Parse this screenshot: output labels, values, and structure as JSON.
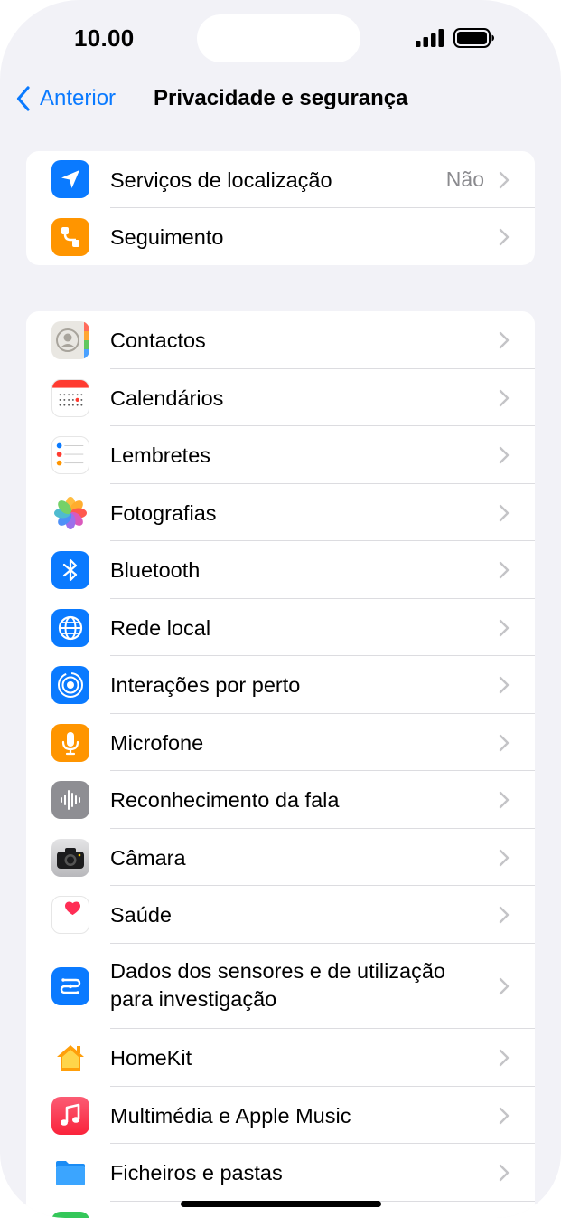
{
  "status_bar": {
    "time": "10.00"
  },
  "nav": {
    "back_label": "Anterior",
    "title": "Privacidade e segurança"
  },
  "group1": [
    {
      "label": "Serviços de localização",
      "value": "Não",
      "icon": "location-arrow-icon"
    },
    {
      "label": "Seguimento",
      "value": "",
      "icon": "tracking-icon"
    }
  ],
  "group2": [
    {
      "label": "Contactos",
      "icon": "contacts-icon"
    },
    {
      "label": "Calendários",
      "icon": "calendar-icon"
    },
    {
      "label": "Lembretes",
      "icon": "reminders-icon"
    },
    {
      "label": "Fotografias",
      "icon": "photos-icon"
    },
    {
      "label": "Bluetooth",
      "icon": "bluetooth-icon"
    },
    {
      "label": "Rede local",
      "icon": "globe-icon"
    },
    {
      "label": "Interações por perto",
      "icon": "nearby-interactions-icon"
    },
    {
      "label": "Microfone",
      "icon": "microphone-icon"
    },
    {
      "label": "Reconhecimento da fala",
      "icon": "waveform-icon"
    },
    {
      "label": "Câmara",
      "icon": "camera-icon"
    },
    {
      "label": "Saúde",
      "icon": "heart-icon"
    },
    {
      "label": "Dados dos sensores e de utilização para investigação",
      "icon": "research-icon"
    },
    {
      "label": "HomeKit",
      "icon": "home-icon"
    },
    {
      "label": "Multimédia e Apple Music",
      "icon": "music-note-icon"
    },
    {
      "label": "Ficheiros e pastas",
      "icon": "folder-icon"
    }
  ],
  "colors": {
    "accent": "#0a7aff",
    "background": "#f2f2f7",
    "secondary_text": "#8a8a8e"
  }
}
